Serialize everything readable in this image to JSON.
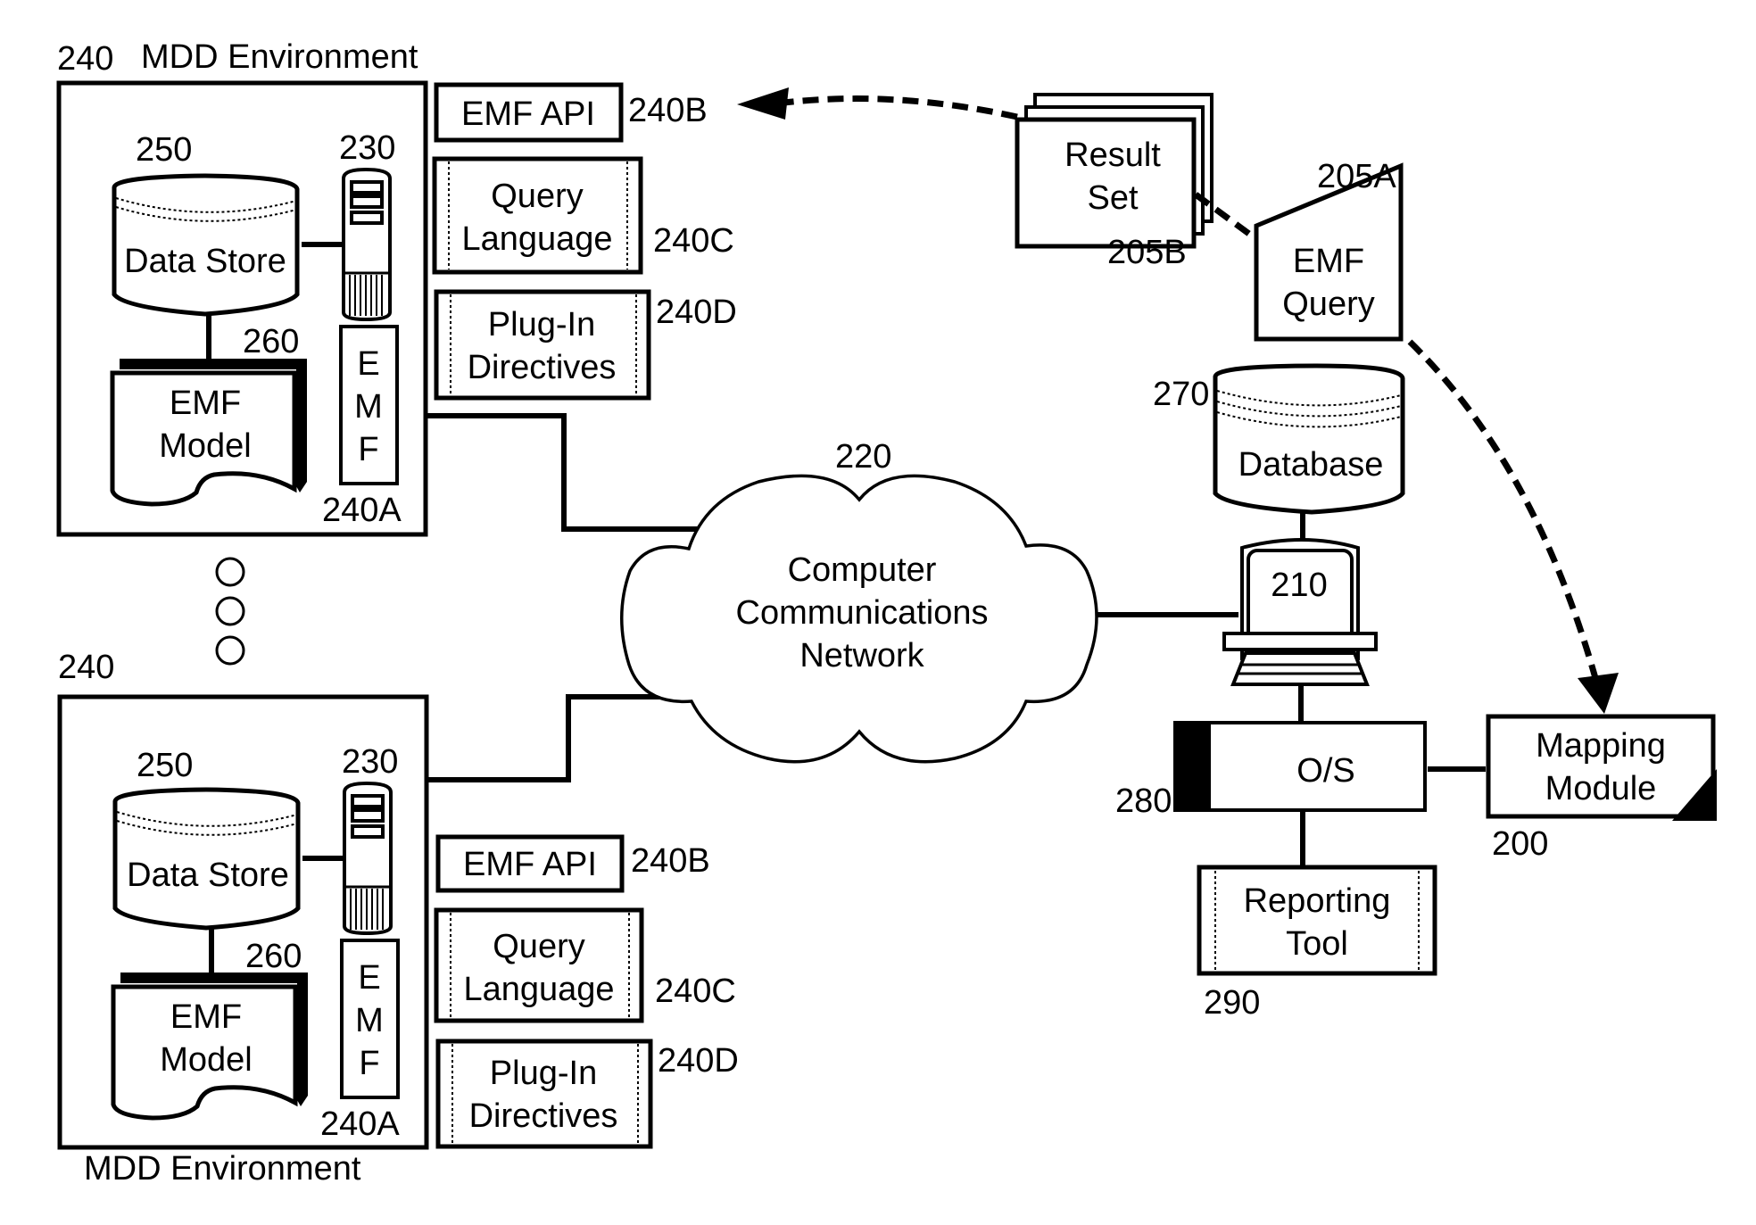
{
  "environments": [
    {
      "ref": "240",
      "title": "MDD Environment",
      "data_store": {
        "ref": "250",
        "label": "Data Store"
      },
      "server": {
        "ref": "230"
      },
      "emf_model": {
        "ref": "260",
        "line1": "EMF",
        "line2": "Model"
      },
      "emf": {
        "ref": "240A",
        "letters": [
          "E",
          "M",
          "F"
        ]
      },
      "emf_api": {
        "ref": "240B",
        "label": "EMF API"
      },
      "query_language": {
        "ref": "240C",
        "line1": "Query",
        "line2": "Language"
      },
      "plugin_directives": {
        "ref": "240D",
        "line1": "Plug-In",
        "line2": "Directives"
      }
    },
    {
      "ref": "240",
      "title": "MDD Environment",
      "data_store": {
        "ref": "250",
        "label": "Data Store"
      },
      "server": {
        "ref": "230"
      },
      "emf_model": {
        "ref": "260",
        "line1": "EMF",
        "line2": "Model"
      },
      "emf": {
        "ref": "240A",
        "letters": [
          "E",
          "M",
          "F"
        ]
      },
      "emf_api": {
        "ref": "240B",
        "label": "EMF API"
      },
      "query_language": {
        "ref": "240C",
        "line1": "Query",
        "line2": "Language"
      },
      "plugin_directives": {
        "ref": "240D",
        "line1": "Plug-In",
        "line2": "Directives"
      }
    }
  ],
  "network": {
    "ref": "220",
    "line1": "Computer",
    "line2": "Communications",
    "line3": "Network"
  },
  "result_set": {
    "ref": "205B",
    "line1": "Result",
    "line2": "Set"
  },
  "emf_query": {
    "ref": "205A",
    "line1": "EMF",
    "line2": "Query"
  },
  "database": {
    "ref": "270",
    "label": "Database"
  },
  "computer": {
    "ref": "210"
  },
  "os": {
    "ref": "280",
    "label": "O/S"
  },
  "mapping_module": {
    "ref": "200",
    "line1": "Mapping",
    "line2": "Module"
  },
  "reporting_tool": {
    "ref": "290",
    "line1": "Reporting",
    "line2": "Tool"
  }
}
